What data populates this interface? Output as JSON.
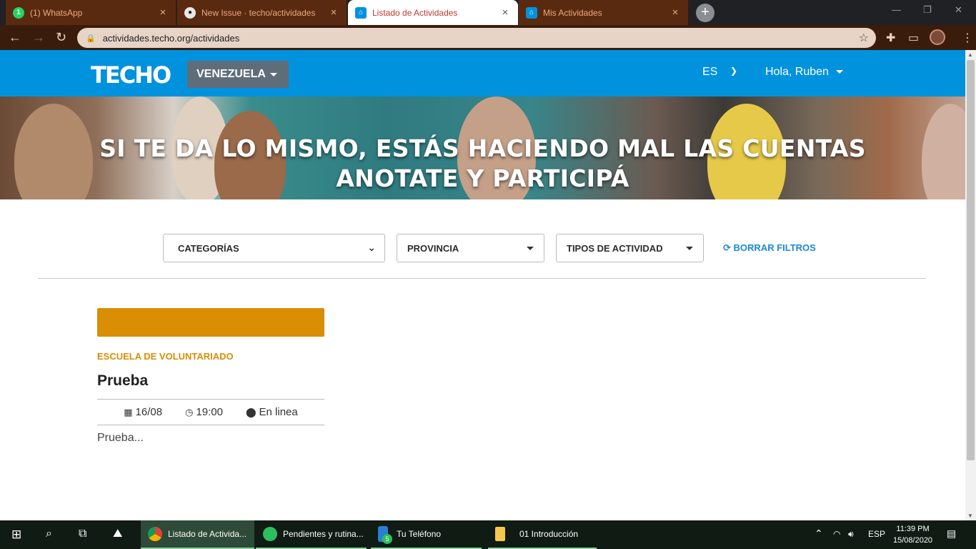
{
  "browser": {
    "tabs": [
      {
        "title": "(1) WhatsApp",
        "icon": "whatsapp-icon",
        "active": false
      },
      {
        "title": "New Issue · techo/actividades",
        "icon": "github-icon",
        "active": false
      },
      {
        "title": "Listado de Actividades",
        "icon": "techo-icon",
        "active": true
      },
      {
        "title": "Mis Actividades",
        "icon": "techo-icon",
        "active": false
      }
    ],
    "tab_close": "×",
    "new_tab": "+",
    "url": "actividades.techo.org/actividades"
  },
  "nav": {
    "logo": "TECHO",
    "country": "VENEZUELA",
    "language": "ES",
    "greeting": "Hola, Ruben"
  },
  "hero": {
    "line1": "SI TE DA LO MISMO, ESTÁS HACIENDO MAL LAS CUENTAS",
    "line2": "ANOTATE Y PARTICIPÁ"
  },
  "filters": {
    "categories": "CATEGORÍAS",
    "province": "PROVINCIA",
    "activity_types": "TIPOS DE ACTIVIDAD",
    "clear": "BORRAR FILTROS"
  },
  "activity": {
    "category": "ESCUELA DE VOLUNTARIADO",
    "category_color": "#d98e03",
    "title": "Prueba",
    "date": "16/08",
    "time": "19:00",
    "location": "En linea",
    "description": "Prueba..."
  },
  "taskbar": {
    "apps": [
      {
        "label": "Listado de Activida...",
        "icon": "chrome-icon",
        "active": true
      },
      {
        "label": "Pendientes y rutina...",
        "icon": "evernote-icon",
        "active": false
      },
      {
        "label": "Tu Teléfono",
        "icon": "phone-icon",
        "active": false,
        "badge": "5"
      },
      {
        "label": "01 Introducción",
        "icon": "folder-icon",
        "active": false
      }
    ],
    "lang": "ESP",
    "time": "11:39 PM",
    "date": "15/08/2020"
  }
}
